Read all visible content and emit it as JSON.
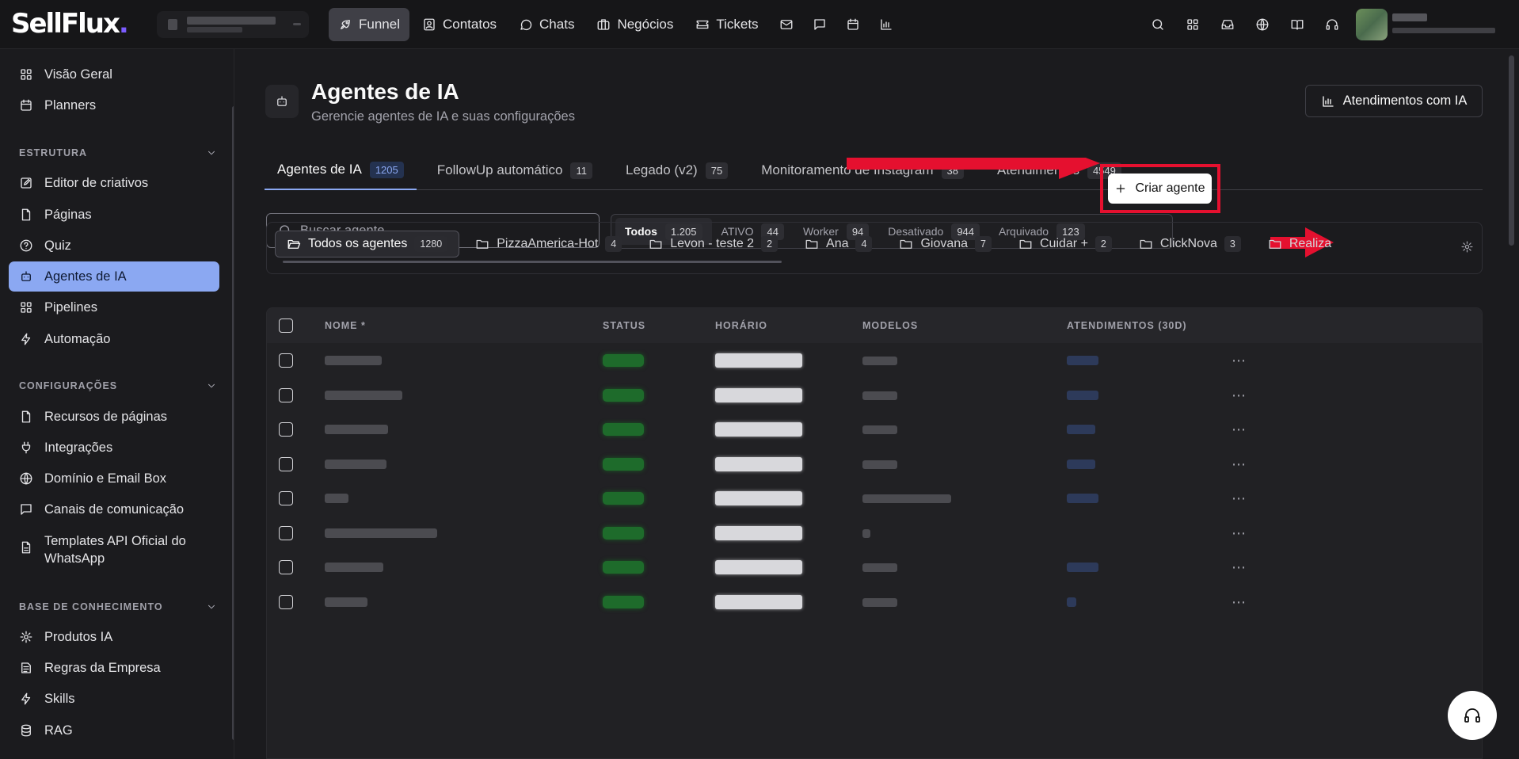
{
  "app": {
    "logo_text": "SellFlux",
    "logo_dot": ".",
    "accent": "#8ba8f2",
    "brand_dot_color": "#7b5cff"
  },
  "nav": {
    "items": [
      {
        "label": "Funnel",
        "icon": "rocket-icon",
        "active": true
      },
      {
        "label": "Contatos",
        "icon": "contact-card-icon"
      },
      {
        "label": "Chats",
        "icon": "chat-bubble-icon"
      },
      {
        "label": "Negócios",
        "icon": "briefcase-icon"
      },
      {
        "label": "Tickets",
        "icon": "ticket-icon"
      }
    ],
    "icon_only": [
      "mail-icon",
      "message-square-icon",
      "calendar-icon",
      "bar-chart-icon"
    ],
    "right_icons": [
      "search-icon",
      "grid-icon",
      "inbox-icon",
      "globe-icon",
      "book-open-icon",
      "headset-icon"
    ]
  },
  "sidebar": {
    "top_items": [
      {
        "label": "Visão Geral",
        "icon": "grid-icon"
      },
      {
        "label": "Planners",
        "icon": "calendar-icon"
      }
    ],
    "sections": [
      {
        "title": "ESTRUTURA",
        "items": [
          {
            "label": "Editor de criativos",
            "icon": "edit-icon"
          },
          {
            "label": "Páginas",
            "icon": "file-icon"
          },
          {
            "label": "Quiz",
            "icon": "help-circle-icon"
          },
          {
            "label": "Agentes de IA",
            "icon": "bot-icon",
            "active": true
          },
          {
            "label": "Pipelines",
            "icon": "grid-icon"
          },
          {
            "label": "Automação",
            "icon": "zap-icon"
          }
        ]
      },
      {
        "title": "CONFIGURAÇÕES",
        "items": [
          {
            "label": "Recursos de páginas",
            "icon": "file-icon"
          },
          {
            "label": "Integrações",
            "icon": "plug-icon"
          },
          {
            "label": "Domínio e Email Box",
            "icon": "globe-icon"
          },
          {
            "label": "Canais de comunicação",
            "icon": "message-square-icon"
          },
          {
            "label": "Templates API Oficial do",
            "label2": "WhatsApp",
            "icon": "file-text-icon"
          }
        ]
      },
      {
        "title": "BASE DE CONHECIMENTO",
        "items": [
          {
            "label": "Produtos IA",
            "icon": "gear-icon"
          },
          {
            "label": "Regras da Empresa",
            "icon": "list-icon"
          },
          {
            "label": "Skills",
            "icon": "zap-icon"
          },
          {
            "label": "RAG",
            "icon": "database-icon"
          }
        ]
      }
    ]
  },
  "page": {
    "title": "Agentes de IA",
    "subtitle": "Gerencie agentes de IA e suas configurações",
    "atendimentos_button": "Atendimentos com IA",
    "create_button": "Criar agente"
  },
  "tabs": [
    {
      "label": "Agentes de IA",
      "count": "1205",
      "active": true
    },
    {
      "label": "FollowUp automático",
      "count": "11"
    },
    {
      "label": "Legado (v2)",
      "count": "75"
    },
    {
      "label": "Monitoramento de Instagram",
      "count": "38"
    },
    {
      "label": "Atendimentos",
      "count": "4549"
    }
  ],
  "search": {
    "placeholder": "Buscar agente..."
  },
  "status_filters": [
    {
      "label": "Todos",
      "count": "1.205",
      "active": true
    },
    {
      "label": "ATIVO",
      "count": "44"
    },
    {
      "label": "Worker",
      "count": "94"
    },
    {
      "label": "Desativado",
      "count": "944"
    },
    {
      "label": "Arquivado",
      "count": "123"
    }
  ],
  "folders": [
    {
      "label": "Todos os agentes",
      "count": "1280",
      "active": true,
      "icon": "folder-open-icon"
    },
    {
      "label": "PizzaAmerica-Hot",
      "count": "4"
    },
    {
      "label": "Levon - teste 2",
      "count": "2"
    },
    {
      "label": "Ana",
      "count": "4"
    },
    {
      "label": "Giovana",
      "count": "7"
    },
    {
      "label": "Cuidar +",
      "count": "2"
    },
    {
      "label": "ClickNova",
      "count": "3"
    },
    {
      "label": "Realiza",
      "count": ""
    }
  ],
  "table": {
    "columns": [
      "NOME *",
      "STATUS",
      "HORÁRIO",
      "MODELOS",
      "ATENDIMENTOS (30D)"
    ],
    "row_count": 8
  }
}
